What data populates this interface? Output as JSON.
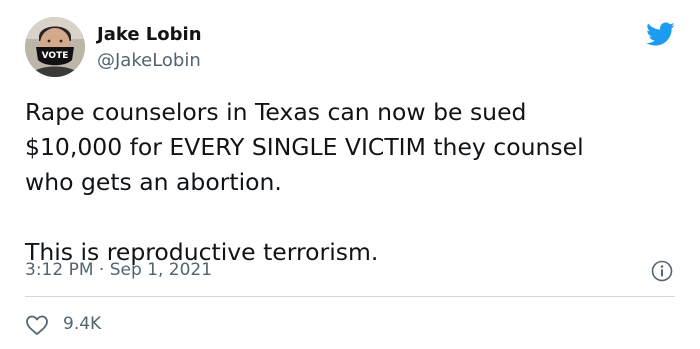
{
  "author": {
    "name": "Jake Lobin",
    "handle": "@JakeLobin",
    "avatar_badge": "VOTE"
  },
  "tweet": {
    "lines": [
      "Rape counselors in Texas can now be sued",
      "$10,000 for EVERY SINGLE VICTIM they counsel",
      "who gets an abortion."
    ],
    "closing": "This is reproductive terrorism."
  },
  "meta": {
    "timestamp": "3:12 PM · Sep 1, 2021"
  },
  "stats": {
    "likes": "9.4K"
  },
  "icons": {
    "brand": "twitter-bird-icon",
    "info": "info-icon",
    "like": "heart-icon"
  },
  "colors": {
    "brand": "#1d9bf0",
    "text": "#0f1419",
    "secondary": "#536471",
    "divider": "#cfd9de"
  }
}
